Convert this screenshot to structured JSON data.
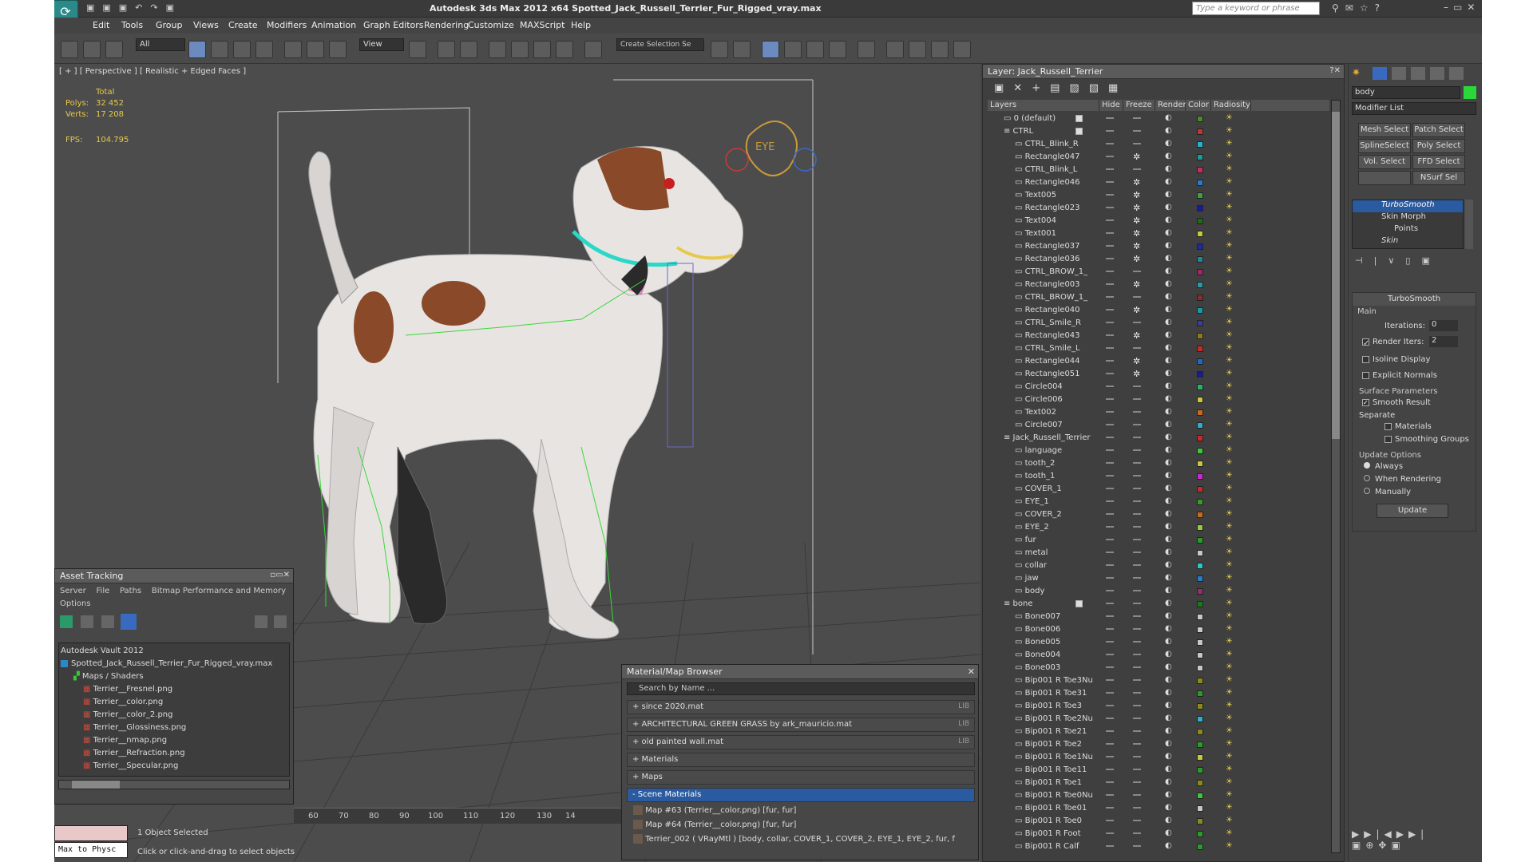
{
  "app": {
    "title": "Autodesk 3ds Max  2012 x64     Spotted_Jack_Russell_Terrier_Fur_Rigged_vray.max",
    "search_placeholder": "Type a keyword or phrase"
  },
  "menu": [
    "Edit",
    "Tools",
    "Group",
    "Views",
    "Create",
    "Modifiers",
    "Animation",
    "Graph Editors",
    "Rendering",
    "Customize",
    "MAXScript",
    "Help"
  ],
  "toolbar": {
    "filter": "All",
    "refcoord": "View",
    "selection_set": "Create Selection Se"
  },
  "viewport": {
    "label": "[ + ] [ Perspective ] [ Realistic + Edged Faces ]",
    "stats": {
      "total": "Total",
      "polys_label": "Polys:",
      "polys": "32 452",
      "verts_label": "Verts:",
      "verts": "17 208",
      "fps_label": "FPS:",
      "fps": "104.795"
    },
    "ruler": [
      "60",
      "70",
      "80",
      "90",
      "100",
      "110",
      "120",
      "130",
      "14"
    ],
    "eye_label": "EYE"
  },
  "layer_panel": {
    "title": "Layer: Jack_Russell_Terrier",
    "headers": [
      "Layers",
      "Hide",
      "Freeze",
      "Render",
      "Color",
      "Radiosity"
    ],
    "rows": [
      {
        "name": "0 (default)",
        "indent": 0,
        "color": "#4a8a2a",
        "freeze": false,
        "box": true
      },
      {
        "name": "CTRL",
        "indent": 0,
        "color": "#c83232",
        "freeze": false,
        "box": true,
        "group": true
      },
      {
        "name": "CTRL_Blink_R",
        "indent": 1,
        "color": "#2ab0c8",
        "freeze": false
      },
      {
        "name": "Rectangle047",
        "indent": 1,
        "color": "#1a9a9a",
        "freeze": true
      },
      {
        "name": "CTRL_Blink_L",
        "indent": 1,
        "color": "#c82a6a",
        "freeze": false
      },
      {
        "name": "Rectangle046",
        "indent": 1,
        "color": "#2a7ac8",
        "freeze": true
      },
      {
        "name": "Text005",
        "indent": 1,
        "color": "#3aa04a",
        "freeze": true
      },
      {
        "name": "Rectangle023",
        "indent": 1,
        "color": "#1a1aa0",
        "freeze": true
      },
      {
        "name": "Text004",
        "indent": 1,
        "color": "#1a6a1a",
        "freeze": true
      },
      {
        "name": "Text001",
        "indent": 1,
        "color": "#c8c83a",
        "freeze": true
      },
      {
        "name": "Rectangle037",
        "indent": 1,
        "color": "#1a2aa0",
        "freeze": true
      },
      {
        "name": "Rectangle036",
        "indent": 1,
        "color": "#1a8a9a",
        "freeze": true
      },
      {
        "name": "CTRL_BROW_1_",
        "indent": 1,
        "color": "#9a2a6a",
        "freeze": false
      },
      {
        "name": "Rectangle003",
        "indent": 1,
        "color": "#2a9aa0",
        "freeze": true
      },
      {
        "name": "CTRL_BROW_1_",
        "indent": 1,
        "color": "#8a2a2a",
        "freeze": false
      },
      {
        "name": "Rectangle040",
        "indent": 1,
        "color": "#1a9aa0",
        "freeze": true
      },
      {
        "name": "CTRL_Smile_R",
        "indent": 1,
        "color": "#3a3aa0",
        "freeze": false
      },
      {
        "name": "Rectangle043",
        "indent": 1,
        "color": "#8a7a1a",
        "freeze": true
      },
      {
        "name": "CTRL_Smile_L",
        "indent": 1,
        "color": "#c82a2a",
        "freeze": false
      },
      {
        "name": "Rectangle044",
        "indent": 1,
        "color": "#1a6ac8",
        "freeze": true
      },
      {
        "name": "Rectangle051",
        "indent": 1,
        "color": "#1a1a9a",
        "freeze": true
      },
      {
        "name": "Circle004",
        "indent": 1,
        "color": "#2ab06a",
        "freeze": false
      },
      {
        "name": "Circle006",
        "indent": 1,
        "color": "#c8c83a",
        "freeze": false
      },
      {
        "name": "Text002",
        "indent": 1,
        "color": "#c86a1a",
        "freeze": false
      },
      {
        "name": "Circle007",
        "indent": 1,
        "color": "#2ab0c8",
        "freeze": false
      },
      {
        "name": "Jack_Russell_Terrier",
        "indent": 0,
        "color": "#c82a2a",
        "freeze": false,
        "group": true,
        "check": true
      },
      {
        "name": "language",
        "indent": 1,
        "color": "#3ac83a",
        "freeze": false
      },
      {
        "name": "tooth_2",
        "indent": 1,
        "color": "#c8c83a",
        "freeze": false
      },
      {
        "name": "tooth_1",
        "indent": 1,
        "color": "#c82ac8",
        "freeze": false
      },
      {
        "name": "COVER_1",
        "indent": 1,
        "color": "#c82a2a",
        "freeze": false
      },
      {
        "name": "EYE_1",
        "indent": 1,
        "color": "#3a9a2a",
        "freeze": false
      },
      {
        "name": "COVER_2",
        "indent": 1,
        "color": "#c86a1a",
        "freeze": false
      },
      {
        "name": "EYE_2",
        "indent": 1,
        "color": "#9ac83a",
        "freeze": false
      },
      {
        "name": "fur",
        "indent": 1,
        "color": "#2a9a2a",
        "freeze": false
      },
      {
        "name": "metal",
        "indent": 1,
        "color": "#c8c8c8",
        "freeze": false
      },
      {
        "name": "collar",
        "indent": 1,
        "color": "#2ac8c8",
        "freeze": false
      },
      {
        "name": "jaw",
        "indent": 1,
        "color": "#2a7ac8",
        "freeze": false
      },
      {
        "name": "body",
        "indent": 1,
        "color": "#9a2a6a",
        "freeze": false
      },
      {
        "name": "bone",
        "indent": 0,
        "color": "#1a7a1a",
        "freeze": false,
        "group": true,
        "box": true
      },
      {
        "name": "Bone007",
        "indent": 1,
        "color": "#c8c8c8",
        "freeze": false
      },
      {
        "name": "Bone006",
        "indent": 1,
        "color": "#c8c8c8",
        "freeze": false
      },
      {
        "name": "Bone005",
        "indent": 1,
        "color": "#c8c8c8",
        "freeze": false
      },
      {
        "name": "Bone004",
        "indent": 1,
        "color": "#c8c8c8",
        "freeze": false
      },
      {
        "name": "Bone003",
        "indent": 1,
        "color": "#c8c8c8",
        "freeze": false
      },
      {
        "name": "Bip001 R Toe3Nu",
        "indent": 1,
        "color": "#8a8a1a",
        "freeze": false
      },
      {
        "name": "Bip001 R Toe31",
        "indent": 1,
        "color": "#2a9a2a",
        "freeze": false
      },
      {
        "name": "Bip001 R Toe3",
        "indent": 1,
        "color": "#8a8a1a",
        "freeze": false
      },
      {
        "name": "Bip001 R Toe2Nu",
        "indent": 1,
        "color": "#2ab0c8",
        "freeze": false
      },
      {
        "name": "Bip001 R Toe21",
        "indent": 1,
        "color": "#8a8a1a",
        "freeze": false
      },
      {
        "name": "Bip001 R Toe2",
        "indent": 1,
        "color": "#2a9a2a",
        "freeze": false
      },
      {
        "name": "Bip001 R Toe1Nu",
        "indent": 1,
        "color": "#c8c83a",
        "freeze": false
      },
      {
        "name": "Bip001 R Toe11",
        "indent": 1,
        "color": "#2a9a2a",
        "freeze": false
      },
      {
        "name": "Bip001 R Toe1",
        "indent": 1,
        "color": "#8a8a1a",
        "freeze": false
      },
      {
        "name": "Bip001 R Toe0Nu",
        "indent": 1,
        "color": "#3ac83a",
        "freeze": false
      },
      {
        "name": "Bip001 R Toe01",
        "indent": 1,
        "color": "#c8c8c8",
        "freeze": false
      },
      {
        "name": "Bip001 R Toe0",
        "indent": 1,
        "color": "#8a8a1a",
        "freeze": false
      },
      {
        "name": "Bip001 R Foot",
        "indent": 1,
        "color": "#2a9a2a",
        "freeze": false
      },
      {
        "name": "Bip001 R Calf",
        "indent": 1,
        "color": "#2a9a2a",
        "freeze": false
      }
    ]
  },
  "asset_tracking": {
    "title": "Asset Tracking",
    "menu": [
      "Server",
      "File",
      "Paths",
      "Bitmap Performance and Memory"
    ],
    "options": "Options",
    "vault": "Autodesk Vault 2012",
    "file": "Spotted_Jack_Russell_Terrier_Fur_Rigged_vray.max",
    "folder": "Maps / Shaders",
    "maps": [
      "Terrier__Fresnel.png",
      "Terrier__color.png",
      "Terrier__color_2.png",
      "Terrier__Glossiness.png",
      "Terrier__nmap.png",
      "Terrier__Refraction.png",
      "Terrier__Specular.png"
    ]
  },
  "material_browser": {
    "title": "Material/Map Browser",
    "search": "Search by Name ...",
    "libs": [
      {
        "label": "+ since 2020.mat",
        "tag": "LIB"
      },
      {
        "label": "+ ARCHITECTURAL GREEN GRASS by ark_mauricio.mat",
        "tag": "LIB"
      },
      {
        "label": "+ old painted wall.mat",
        "tag": "LIB"
      },
      {
        "label": "+ Materials",
        "tag": ""
      },
      {
        "label": "+ Maps",
        "tag": ""
      }
    ],
    "scene": "- Scene Materials",
    "items": [
      "Map #63 (Terrier__color.png)  [fur, fur]",
      "Map #64 (Terrier__color.png)  [fur, fur]",
      "Terrier_002  ( VRayMtl )  [body, collar, COVER_1, COVER_2, EYE_1, EYE_2, fur, f"
    ]
  },
  "command_panel": {
    "object_name": "body",
    "modifier_list": "Modifier List",
    "buttons": [
      "Mesh Select",
      "Patch Select",
      "SplineSelect",
      "Poly Select",
      "Vol. Select",
      "FFD Select",
      "",
      "NSurf Sel"
    ],
    "stack": [
      "TurboSmooth",
      "Skin Morph",
      "Points",
      "Skin"
    ],
    "rollout": "TurboSmooth",
    "main": "Main",
    "iterations_label": "Iterations:",
    "iterations": "0",
    "render_iters_label": "Render Iters:",
    "render_iters": "2",
    "isoline": "Isoline Display",
    "explicit": "Explicit Normals",
    "surface": "Surface Parameters",
    "smooth_result": "Smooth Result",
    "separate": "Separate",
    "materials": "Materials",
    "smoothing_groups": "Smoothing Groups",
    "update_options": "Update Options",
    "always": "Always",
    "when_rendering": "When Rendering",
    "manually": "Manually",
    "update": "Update"
  },
  "status": {
    "maxscript": "Max to Physc",
    "selected": "1 Object Selected",
    "prompt": "Click or click-and-drag to select objects"
  }
}
